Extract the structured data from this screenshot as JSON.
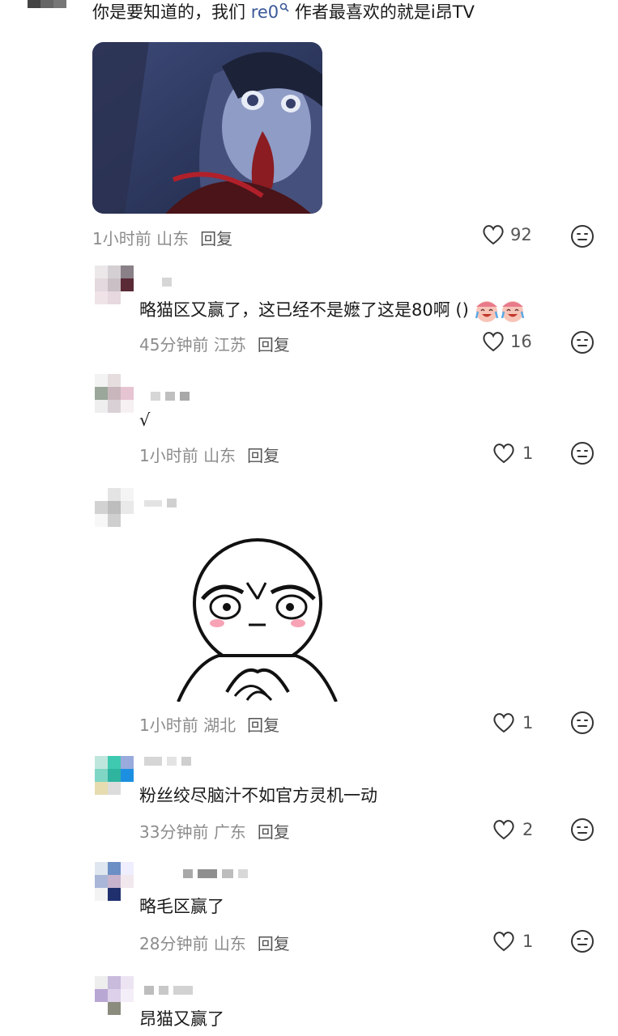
{
  "top_comment": {
    "text_before": "你是要知道的，我们 ",
    "link": "re0",
    "text_after": " 作者最喜欢的就是i昂TV",
    "image_alt": "anime-screenshot",
    "time": "1小时前",
    "location": "山东",
    "reply_label": "回复",
    "likes": "92"
  },
  "replies": [
    {
      "text": "略猫区又赢了，这已经不是嬷了这是80啊 ()",
      "time": "45分钟前",
      "location": "江苏",
      "reply_label": "回复",
      "likes": "16"
    },
    {
      "text": "√",
      "time": "1小时前",
      "location": "山东",
      "reply_label": "回复",
      "likes": "1"
    },
    {
      "text": "",
      "time": "1小时前",
      "location": "湖北",
      "reply_label": "回复",
      "likes": "1",
      "sticker": "staring-meme-sticker"
    },
    {
      "text": "粉丝绞尽脑汁不如官方灵机一动",
      "time": "33分钟前",
      "location": "广东",
      "reply_label": "回复",
      "likes": "2"
    },
    {
      "text": "略毛区赢了",
      "time": "28分钟前",
      "location": "山东",
      "reply_label": "回复",
      "likes": "1"
    },
    {
      "text": "昂猫又赢了",
      "time": "",
      "location": "",
      "reply_label": "",
      "likes": ""
    }
  ],
  "icons": {
    "like": "heart-outline-icon",
    "react": "emoji-face-icon",
    "emoji": "crying-laugh-emoji"
  },
  "colors": {
    "meta": "#8c8c8c",
    "link": "#3b5998"
  }
}
